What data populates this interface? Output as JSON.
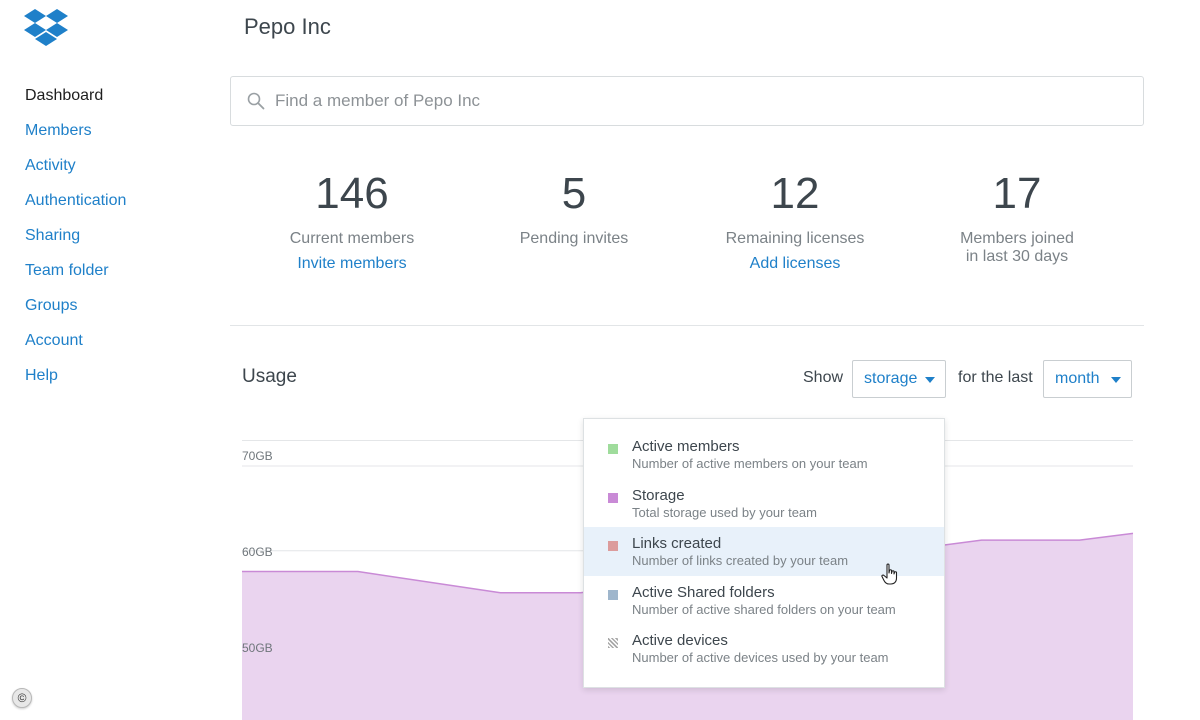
{
  "team_name": "Pepo Inc",
  "sidebar": {
    "items": [
      {
        "label": "Dashboard",
        "name": "dashboard"
      },
      {
        "label": "Members",
        "name": "members"
      },
      {
        "label": "Activity",
        "name": "activity"
      },
      {
        "label": "Authentication",
        "name": "authentication"
      },
      {
        "label": "Sharing",
        "name": "sharing"
      },
      {
        "label": "Team folder",
        "name": "team-folder"
      },
      {
        "label": "Groups",
        "name": "groups"
      },
      {
        "label": "Account",
        "name": "account"
      },
      {
        "label": "Help",
        "name": "help"
      }
    ],
    "active": "Dashboard"
  },
  "search": {
    "placeholder": "Find a member of Pepo Inc"
  },
  "stats": [
    {
      "value": "146",
      "label": "Current members",
      "link": "Invite members"
    },
    {
      "value": "5",
      "label": "Pending invites",
      "link": ""
    },
    {
      "value": "12",
      "label": "Remaining licenses",
      "link": "Add licenses"
    },
    {
      "value": "17",
      "label": "Members joined",
      "label2": "in last 30 days",
      "link": ""
    }
  ],
  "usage": {
    "title": "Usage",
    "show_label": "Show",
    "metric_selected": "storage",
    "for_label": "for the last",
    "period_selected": "month"
  },
  "dropdown": {
    "options": [
      {
        "title": "Active members",
        "desc": "Number of active members on your team",
        "color": "#9fdc9c",
        "hatched": false
      },
      {
        "title": "Storage",
        "desc": "Total storage used by your team",
        "color": "#c98ad6",
        "hatched": false
      },
      {
        "title": "Links created",
        "desc": "Number of links created by your team",
        "color": "#dc9c9c",
        "hatched": false
      },
      {
        "title": "Active Shared folders",
        "desc": "Number of active shared folders on your team",
        "color": "#9fb6cc",
        "hatched": false
      },
      {
        "title": "Active devices",
        "desc": "Number of active devices used by your team",
        "color": "#a8a8a8",
        "hatched": true
      }
    ],
    "hovered_index": 2
  },
  "chart_data": {
    "type": "area",
    "y_ticks": [
      "70GB",
      "60GB",
      "50GB"
    ],
    "ylim": [
      40,
      73
    ],
    "series": [
      {
        "color": "#c98ad6",
        "fill": "#ead4ef",
        "points": [
          [
            0,
            57.5
          ],
          [
            0.13,
            57.5
          ],
          [
            0.29,
            55.0
          ],
          [
            0.38,
            55.0
          ],
          [
            0.83,
            61.2
          ],
          [
            0.94,
            61.2
          ],
          [
            1.0,
            62.0
          ]
        ]
      }
    ]
  },
  "copyright_symbol": "©"
}
